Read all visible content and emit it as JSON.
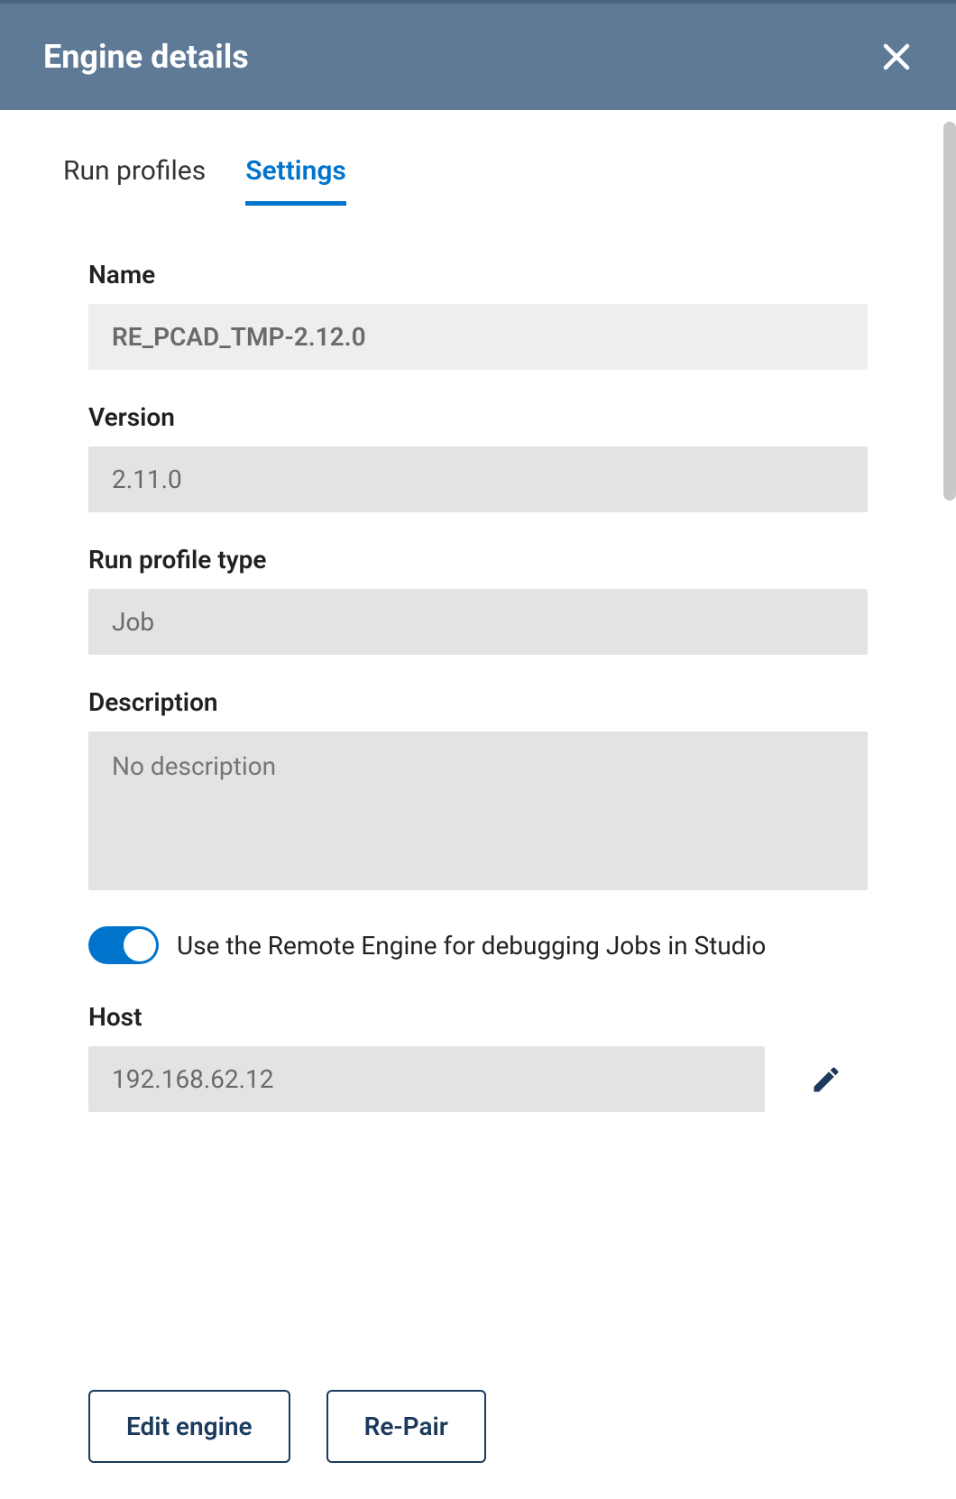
{
  "header": {
    "title": "Engine details"
  },
  "tabs": {
    "run_profiles": "Run profiles",
    "settings": "Settings"
  },
  "fields": {
    "name": {
      "label": "Name",
      "value": "RE_PCAD_TMP-2.12.0"
    },
    "version": {
      "label": "Version",
      "value": "2.11.0"
    },
    "run_profile_type": {
      "label": "Run profile type",
      "value": "Job"
    },
    "description": {
      "label": "Description",
      "placeholder": "No description"
    },
    "debug_toggle": {
      "label": "Use the Remote Engine for debugging Jobs in Studio"
    },
    "host": {
      "label": "Host",
      "value": "192.168.62.12"
    }
  },
  "buttons": {
    "edit_engine": "Edit engine",
    "re_pair": "Re-Pair"
  }
}
